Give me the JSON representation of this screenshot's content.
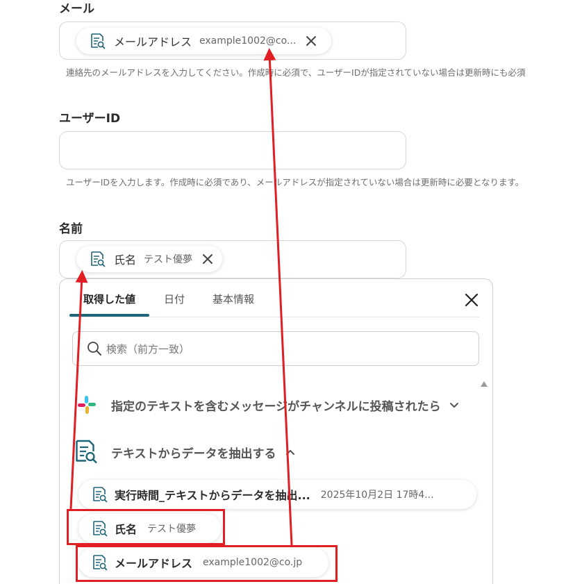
{
  "fields": {
    "mail": {
      "label": "メール",
      "chip_name": "メールアドレス",
      "chip_value": "example1002@co...",
      "hint": "連絡先のメールアドレスを入力してください。作成時に必須で、ユーザーIDが指定されていない場合は更新時にも必須"
    },
    "user_id": {
      "label": "ユーザーID",
      "value": "",
      "hint": "ユーザーIDを入力します。作成時に必須であり、メールアドレスが指定されていない場合は更新時に必要となります。"
    },
    "name": {
      "label": "名前",
      "chip_name": "氏名",
      "chip_value": "テスト優夢"
    }
  },
  "panel": {
    "tabs": [
      {
        "label": "取得した値",
        "active": true
      },
      {
        "label": "日付",
        "active": false
      },
      {
        "label": "基本情報",
        "active": false
      }
    ],
    "search_placeholder": "検索（前方一致）",
    "groups": [
      {
        "title": "指定のテキストを含むメッセージがチャンネルに投稿されたら",
        "icon": "slack-icon",
        "expanded": false
      },
      {
        "title": "テキストからデータを抽出する",
        "icon": "document-search-icon",
        "expanded": true
      }
    ],
    "results": [
      {
        "name": "実行時間_テキストからデータを抽出...",
        "value": "2025年10月2日 17時4..."
      },
      {
        "name": "氏名",
        "value": "テスト優夢"
      },
      {
        "name": "メールアドレス",
        "value": "example1002@co.jp"
      }
    ]
  },
  "annotation_color": "#e01e24",
  "accent_color": "#1e6478"
}
